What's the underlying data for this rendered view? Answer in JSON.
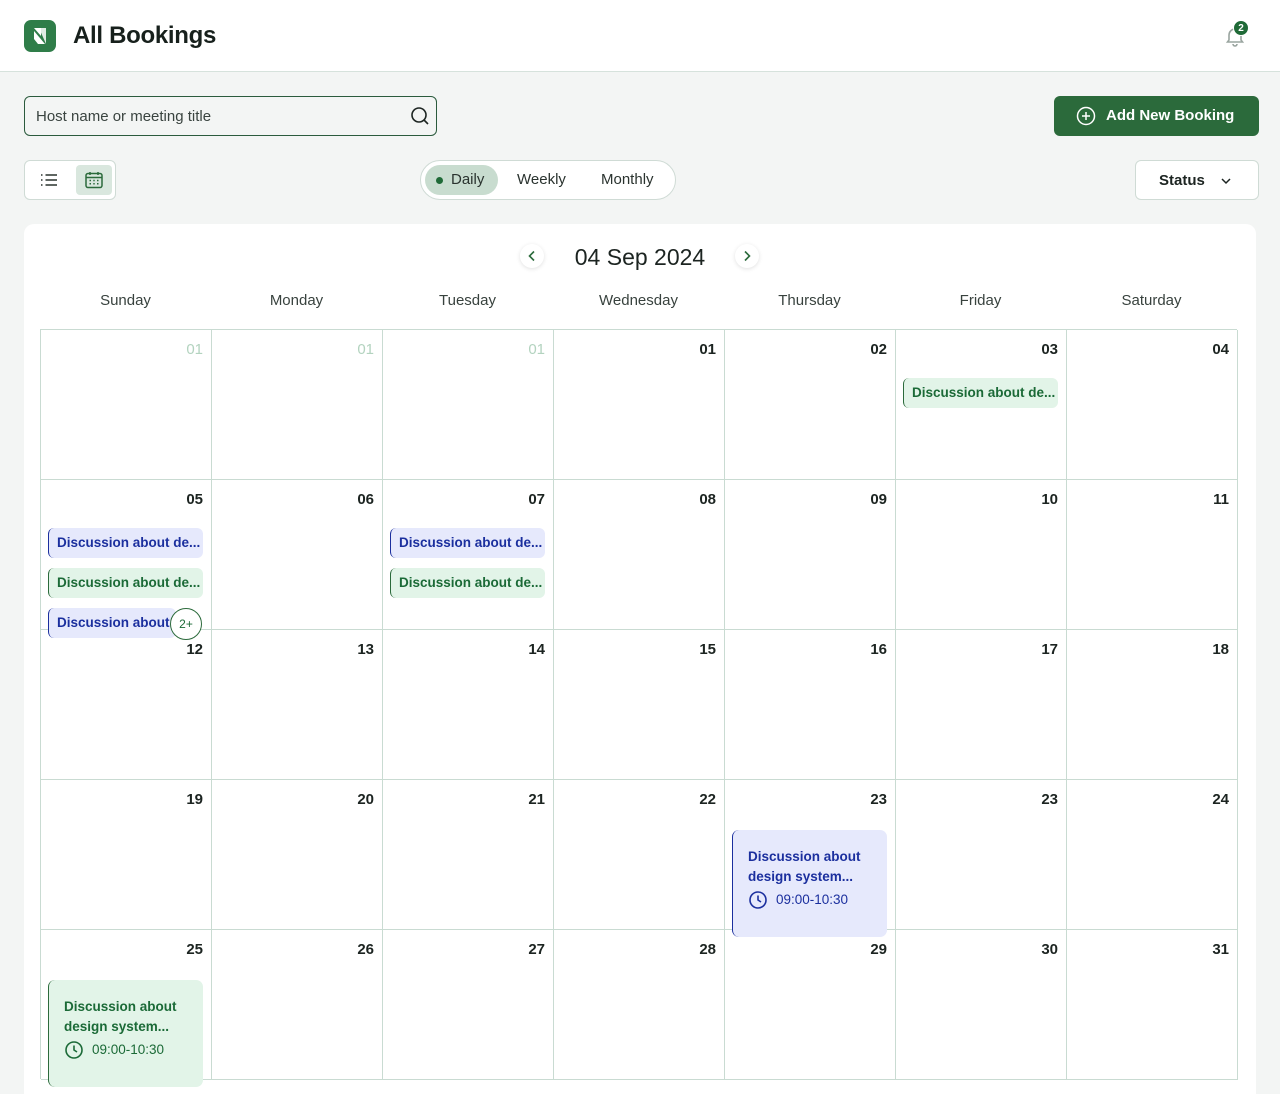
{
  "header": {
    "title": "All Bookings",
    "notification_count": "2"
  },
  "search": {
    "placeholder": "Host name or meeting title",
    "value": ""
  },
  "actions": {
    "add_label": "Add New Booking"
  },
  "range": {
    "daily": "Daily",
    "weekly": "Weekly",
    "monthly": "Monthly",
    "selected": "Daily"
  },
  "filter": {
    "status_label": "Status"
  },
  "calendar": {
    "title": "04 Sep 2024",
    "weekdays": [
      "Sunday",
      "Monday",
      "Tuesday",
      "Wednesday",
      "Thursday",
      "Friday",
      "Saturday"
    ],
    "rows": [
      [
        "01",
        "01",
        "01",
        "01",
        "02",
        "03",
        "04"
      ],
      [
        "05",
        "06",
        "07",
        "08",
        "09",
        "10",
        "11"
      ],
      [
        "12",
        "13",
        "14",
        "15",
        "16",
        "17",
        "18"
      ],
      [
        "19",
        "20",
        "21",
        "22",
        "23",
        "23",
        "24"
      ],
      [
        "25",
        "26",
        "27",
        "28",
        "29",
        "30",
        "31"
      ]
    ],
    "events": {
      "fri_03": "Discussion about de...",
      "sun_05_a": "Discussion about de...",
      "sun_05_b": "Discussion about de...",
      "sun_05_c": "Discussion about d",
      "tue_07_a": "Discussion about de...",
      "tue_07_b": "Discussion about de...",
      "more_label": "2+",
      "thu_23_title": "Discussion about design system...",
      "thu_23_time": "09:00-10:30",
      "sun_25_title": "Discussion about design system...",
      "sun_25_time": "09:00-10:30"
    }
  },
  "colors": {
    "brand": "#2b6a3b",
    "event_green_bg": "#e2f4e8",
    "event_blue_bg": "#e6e9fc",
    "event_blue_text": "#1b2f9e"
  }
}
